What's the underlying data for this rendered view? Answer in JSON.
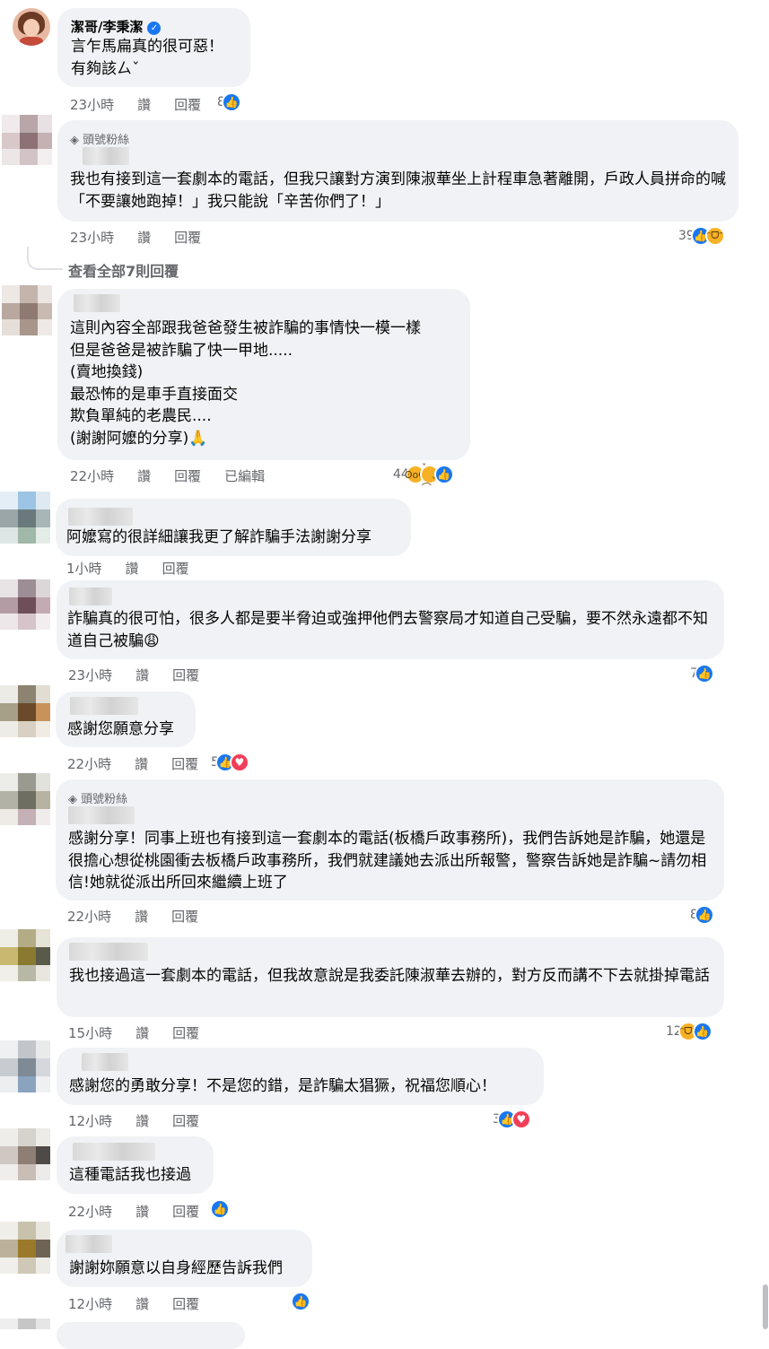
{
  "comments": [
    {
      "author": "潔哥/李秉潔",
      "author_verified": true,
      "text": "言乍馬扁真的很可惡！\n有夠該ㄙˇ",
      "time": "23小時",
      "like_label": "讚",
      "reply_label": "回覆",
      "reaction_count": "8",
      "reactions": [
        "like"
      ]
    },
    {
      "badge": "頭號粉絲",
      "text": "我也有接到這一套劇本的電話，但我只讓對方演到陳淑華坐上計程車急著離開，戶政人員拼命的喊「不要讓她跑掉！」我只能說「辛苦你們了！」",
      "time": "23小時",
      "like_label": "讚",
      "reply_label": "回覆",
      "reaction_count": "39",
      "reactions": [
        "like",
        "haha"
      ],
      "view_replies": "查看全部7則回覆"
    },
    {
      "text": "這則內容全部跟我爸爸發生被詐騙的事情快一模一樣\n但是爸爸是被詐騙了快一甲地.....\n(賣地換錢)\n最恐怖的是車手直接面交\n欺負單純的老農民....\n(謝謝阿嬤的分享)🙏",
      "time": "22小時",
      "like_label": "讚",
      "reply_label": "回覆",
      "edited_label": "已編輯",
      "reaction_count": "44",
      "reactions": [
        "wow",
        "sad",
        "like"
      ]
    },
    {
      "text": "阿嬤寫的很詳細讓我更了解詐騙手法謝謝分享",
      "time": "1小時",
      "like_label": "讚",
      "reply_label": "回覆"
    },
    {
      "text": "詐騙真的很可怕，很多人都是要半脅迫或強押他們去警察局才知道自己受騙，要不然永遠都不知道自己被騙😩",
      "time": "23小時",
      "like_label": "讚",
      "reply_label": "回覆",
      "reaction_count": "7",
      "reactions": [
        "like"
      ]
    },
    {
      "text": "感謝您願意分享",
      "time": "22小時",
      "like_label": "讚",
      "reply_label": "回覆",
      "reaction_count": "5",
      "reactions": [
        "like",
        "love"
      ]
    },
    {
      "badge": "頭號粉絲",
      "text": "感謝分享！同事上班也有接到這一套劇本的電話(板橋戶政事務所)，我們告訴她是詐騙，她還是很擔心想從桃園衝去板橋戶政事務所，我們就建議她去派出所報警，警察告訴她是詐騙~請勿相信!她就從派出所回來繼續上班了",
      "time": "22小時",
      "like_label": "讚",
      "reply_label": "回覆",
      "reaction_count": "8",
      "reactions": [
        "like"
      ]
    },
    {
      "text": "我也接過這一套劇本的電話，但我故意說是我委託陳淑華去辦的，對方反而講不下去就掛掉電話",
      "time": "15小時",
      "like_label": "讚",
      "reply_label": "回覆",
      "reaction_count": "12",
      "reactions": [
        "haha",
        "like"
      ]
    },
    {
      "text": "感謝您的勇敢分享！不是您的錯，是詐騙太猖獗，祝福您順心！",
      "time": "12小時",
      "like_label": "讚",
      "reply_label": "回覆",
      "reaction_count": "3",
      "reactions": [
        "like",
        "love"
      ]
    },
    {
      "text": "這種電話我也接過",
      "time": "22小時",
      "like_label": "讚",
      "reply_label": "回覆",
      "reactions": [
        "like"
      ]
    },
    {
      "text": "謝謝妳願意以自身經歷告訴我們",
      "time": "12小時",
      "like_label": "讚",
      "reply_label": "回覆",
      "reactions": [
        "like"
      ]
    }
  ],
  "colors": {
    "bubble": "#f0f2f5",
    "meta_text": "#65676b",
    "like_blue": "#1877f2",
    "love_red": "#f33e58",
    "haha_yellow": "#f7b125"
  }
}
